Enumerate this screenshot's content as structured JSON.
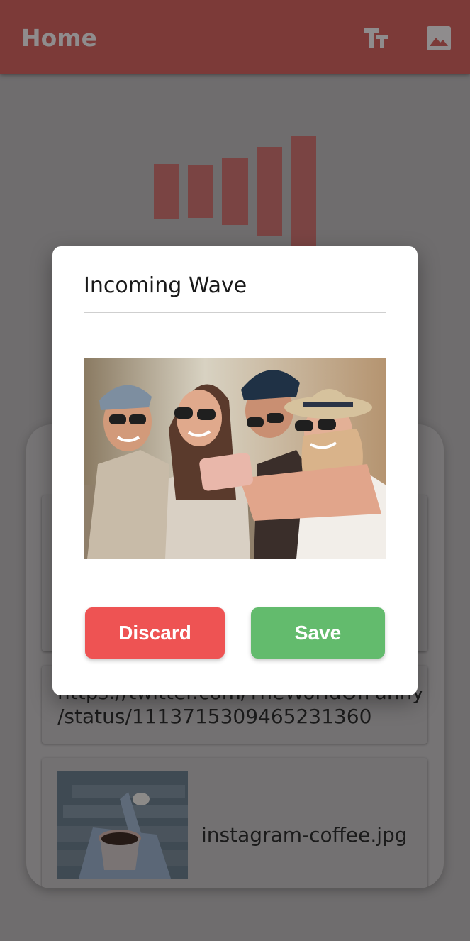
{
  "appbar": {
    "title": "Home",
    "icons": [
      "text-size-icon",
      "image-icon"
    ]
  },
  "list": {
    "items": [
      {
        "type": "link",
        "text_line1": "https://twitter.com/TheWorldOfFunny",
        "text_line2": "/status/1113715309465231360"
      },
      {
        "type": "image",
        "file_name": "instagram-coffee.jpg"
      }
    ]
  },
  "dialog": {
    "title": "Incoming Wave",
    "discard_label": "Discard",
    "save_label": "Save"
  },
  "colors": {
    "appbar": "#7c3a38",
    "discard": "#ee5353",
    "save": "#63bb6d",
    "overlay_background": "#6f6d6e"
  }
}
